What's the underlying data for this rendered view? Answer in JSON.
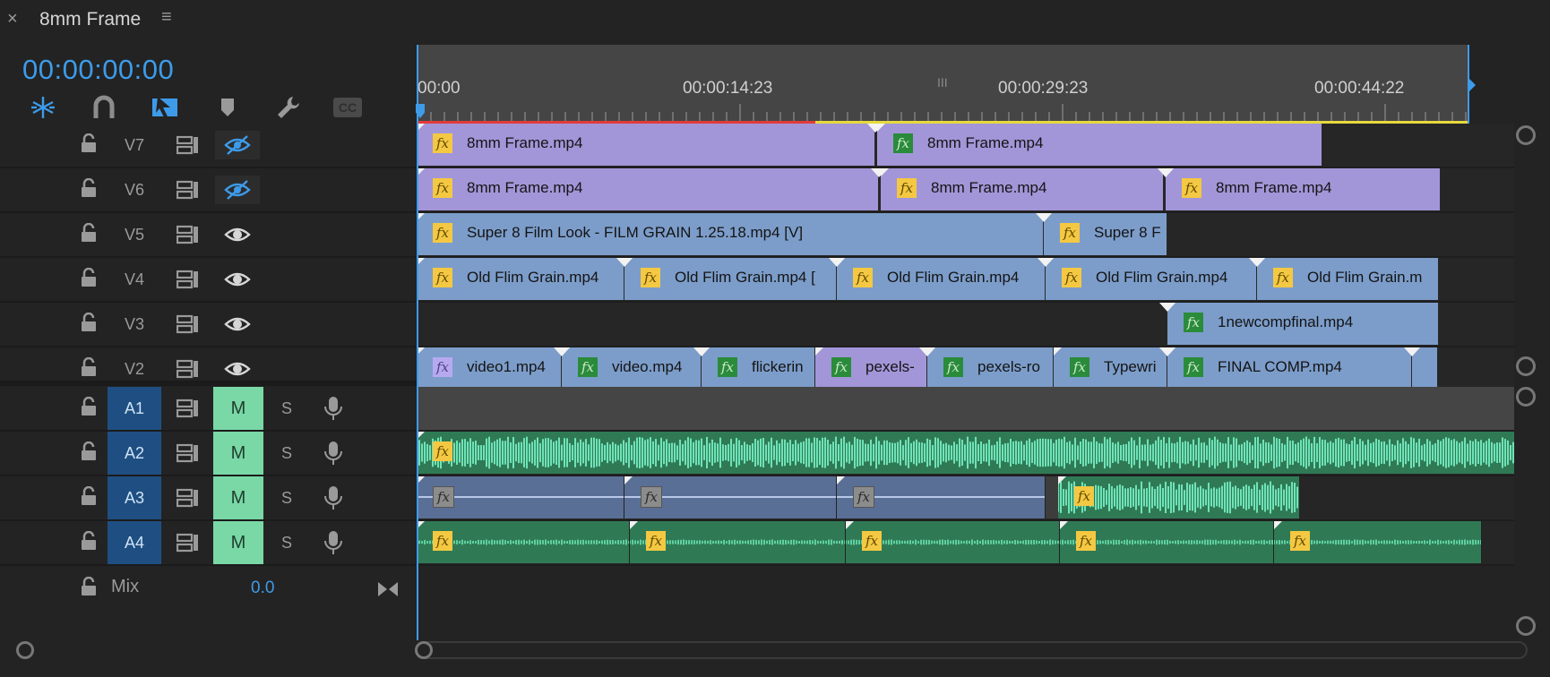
{
  "header": {
    "close_glyph": "×",
    "title": "8mm Frame",
    "menu_glyph": "≡",
    "timecode": "00:00:00:00",
    "tools": [
      {
        "name": "snap-tool-icon"
      },
      {
        "name": "linked-selection-icon"
      },
      {
        "name": "insert-overwrite-icon"
      },
      {
        "name": "add-marker-icon"
      },
      {
        "name": "wrench-icon"
      },
      {
        "name": "captions-icon"
      }
    ]
  },
  "ruler": {
    "labels": [
      "00:00",
      "00:00:14:23",
      "00:00:29:23",
      "00:00:44:22"
    ],
    "grip": "III"
  },
  "video_tracks": [
    {
      "name": "V7",
      "visibility": "hidden",
      "clips": [
        {
          "label": "8mm Frame.mp4",
          "fx": "yellow"
        },
        {
          "label": "8mm Frame.mp4",
          "fx": "green"
        }
      ]
    },
    {
      "name": "V6",
      "visibility": "hidden",
      "clips": [
        {
          "label": "8mm Frame.mp4",
          "fx": "yellow"
        },
        {
          "label": "8mm Frame.mp4",
          "fx": "yellow"
        },
        {
          "label": "8mm Frame.mp4",
          "fx": "yellow"
        }
      ]
    },
    {
      "name": "V5",
      "visibility": "visible",
      "clips": [
        {
          "label": "Super 8 Film Look - FILM GRAIN 1.25.18.mp4 [V]",
          "fx": "yellow"
        },
        {
          "label": "Super 8 F",
          "fx": "yellow"
        }
      ]
    },
    {
      "name": "V4",
      "visibility": "visible",
      "clips": [
        {
          "label": "Old Flim Grain.mp4",
          "fx": "yellow"
        },
        {
          "label": "Old Flim Grain.mp4 [",
          "fx": "yellow"
        },
        {
          "label": "Old Flim Grain.mp4",
          "fx": "yellow"
        },
        {
          "label": "Old Flim Grain.mp4",
          "fx": "yellow"
        },
        {
          "label": "Old Flim Grain.m",
          "fx": "yellow"
        }
      ]
    },
    {
      "name": "V3",
      "visibility": "visible",
      "clips": [
        {
          "label": "1newcompfinal.mp4",
          "fx": "green"
        }
      ]
    },
    {
      "name": "V2",
      "visibility": "visible",
      "clips": [
        {
          "label": "video1.mp4",
          "fx": "lav"
        },
        {
          "label": "video.mp4",
          "fx": "green"
        },
        {
          "label": "flickerin",
          "fx": "green"
        },
        {
          "label": "pexels-",
          "fx": "green"
        },
        {
          "label": "pexels-ro",
          "fx": "green"
        },
        {
          "label": "Typewri",
          "fx": "green"
        },
        {
          "label": "FINAL COMP.mp4",
          "fx": "green"
        }
      ]
    }
  ],
  "audio_tracks": [
    {
      "name": "A1",
      "mute": "M",
      "solo": "S"
    },
    {
      "name": "A2",
      "mute": "M",
      "solo": "S"
    },
    {
      "name": "A3",
      "mute": "M",
      "solo": "S"
    },
    {
      "name": "A4",
      "mute": "M",
      "solo": "S"
    }
  ],
  "mix": {
    "label": "Mix",
    "value": "0.0"
  },
  "fx_text": "fx",
  "colors": {
    "accent": "#3d9bea",
    "video_purple": "#a296d8",
    "video_blue": "#7c9dca",
    "audio_green": "#2f7a55",
    "waveform": "#6fe3b8",
    "mute_on": "#79d8a6",
    "target_blue": "#1f4f82"
  }
}
